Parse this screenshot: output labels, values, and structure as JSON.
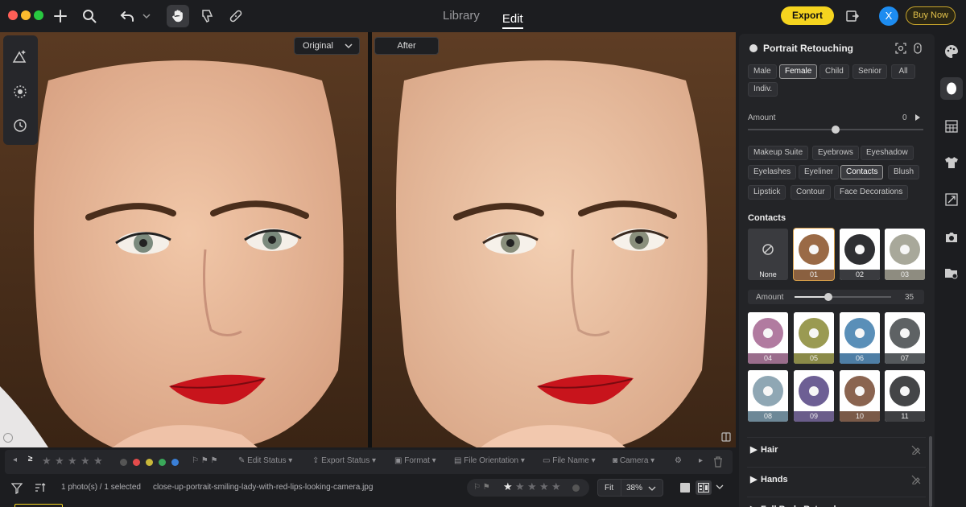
{
  "toolbar": {
    "tabs": [
      "Library",
      "Edit"
    ],
    "export_label": "Export",
    "avatar_initial": "X",
    "buy_now_label": "Buy Now"
  },
  "canvas": {
    "original_label": "Original",
    "after_label": "After"
  },
  "panel": {
    "title": "Portrait Retouching",
    "gender_chips": [
      "Male",
      "Female",
      "Child",
      "Senior",
      "All",
      "Indiv."
    ],
    "selected_gender": "Female",
    "amount_label": "Amount",
    "amount_value": "0",
    "amount_level": 0.5,
    "makeup_chips": [
      "Makeup Suite",
      "Eyebrows",
      "Eyeshadow",
      "Eyelashes",
      "Eyeliner",
      "Contacts",
      "Blush",
      "Lipstick",
      "Contour",
      "Face Decorations"
    ],
    "selected_makeup": "Contacts",
    "contacts_heading": "Contacts",
    "none_label": "None",
    "contacts_amount_label": "Amount",
    "contacts_amount_value": "35",
    "contacts_amount_level": 0.35,
    "swatch_numbers": [
      "01",
      "02",
      "03",
      "04",
      "05",
      "06",
      "07",
      "08",
      "09",
      "10",
      "11"
    ],
    "swatch_colors": [
      "#9a6a46",
      "#2e2f32",
      "#a8a89a",
      "#b17ba0",
      "#9a9a52",
      "#5a8fb8",
      "#5e6264",
      "#8fa7b4",
      "#6d5f94",
      "#8a6450",
      "#444547"
    ],
    "swatch_bands": [
      "#8a6040",
      "#3a3b3f",
      "#8e8c80",
      "#9a6d8c",
      "#8a8a48",
      "#4e7ea5",
      "#55595c",
      "#6d8897",
      "#6a5d8a",
      "#7a5a48",
      "#3e3f42"
    ],
    "sections": [
      "Hair",
      "Hands",
      "Full Body Retouch"
    ]
  },
  "bottom": {
    "stars_count": 5,
    "label_colors": [
      "#e34b4b",
      "#c9b83a",
      "#3aa85a",
      "#3a7fd6"
    ],
    "filters": [
      "Edit Status",
      "Export Status",
      "Format",
      "File Orientation",
      "File Name",
      "Camera"
    ],
    "selection_text": "1 photo(s) / 1 selected",
    "file_name": "close-up-portrait-smiling-lady-with-red-lips-looking-camera.jpg",
    "fit_label": "Fit",
    "zoom_value": "38%"
  },
  "colors": {
    "accent_yellow": "#f5d41f",
    "avatar_blue": "#1d8cf0",
    "buy_now_gold": "#e2c14b"
  }
}
